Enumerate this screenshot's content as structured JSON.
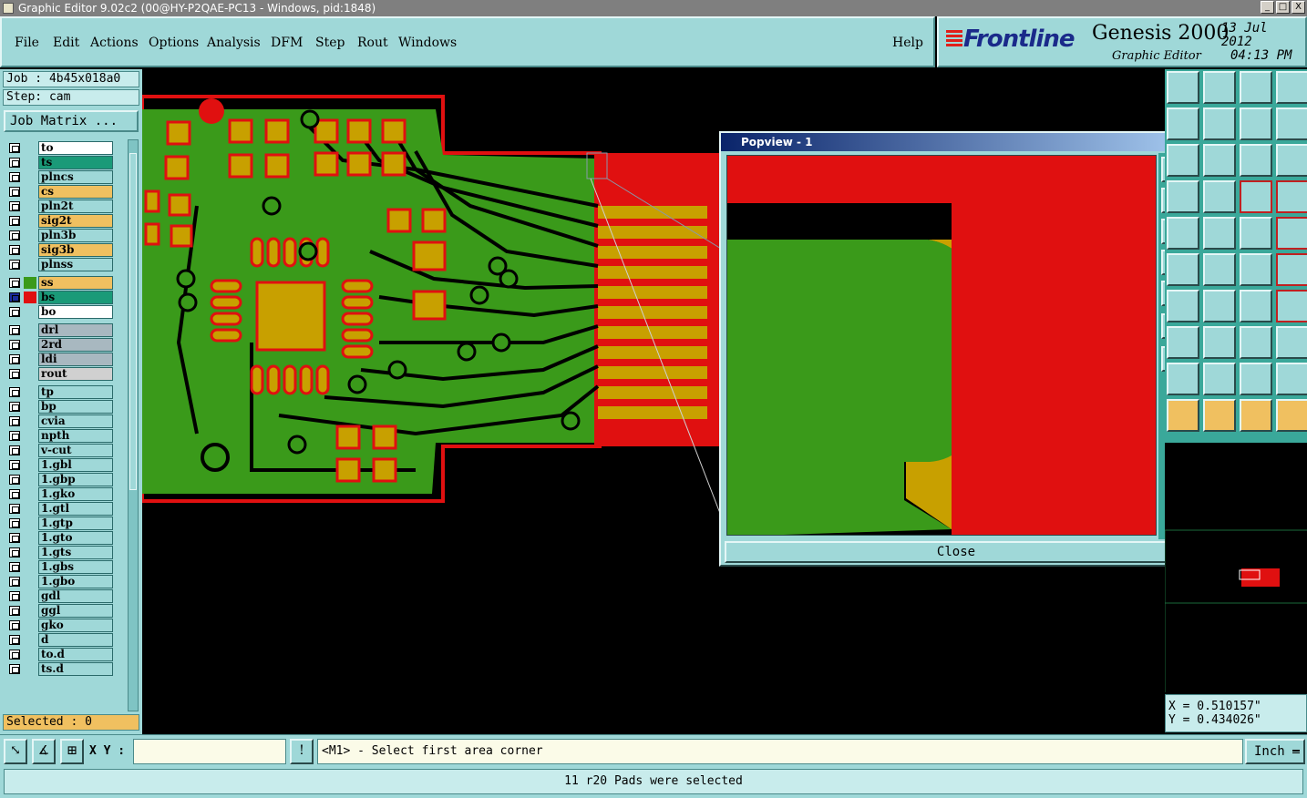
{
  "window": {
    "title": "Graphic Editor 9.02c2 (00@HY-P2QAE-PC13 - Windows, pid:1848)",
    "controls": [
      "_",
      "□",
      "X"
    ]
  },
  "menu": {
    "items": [
      "File",
      "Edit",
      "Actions",
      "Options",
      "Analysis",
      "DFM",
      "Step",
      "Rout",
      "Windows"
    ],
    "help": "Help"
  },
  "brand": {
    "logo": "Frontline",
    "product": "Genesis 2000",
    "subtitle": "Graphic Editor",
    "date": "13 Jul 2012",
    "time": "04:13 PM"
  },
  "job": {
    "job_line": "Job : 4b45x018a0",
    "step_line": "Step: cam",
    "matrix_button": "Job Matrix ..."
  },
  "layers": [
    {
      "name": "to",
      "color": "#ffffff"
    },
    {
      "name": "ts",
      "color": "#1a9a78"
    },
    {
      "name": "plncs",
      "color": "#9fd8d8"
    },
    {
      "name": "cs",
      "color": "#f0c060"
    },
    {
      "name": "pln2t",
      "color": "#9fd8d8"
    },
    {
      "name": "sig2t",
      "color": "#f0c060"
    },
    {
      "name": "pln3b",
      "color": "#9fd8d8"
    },
    {
      "name": "sig3b",
      "color": "#f0c060"
    },
    {
      "name": "plnss",
      "color": "#9fd8d8"
    },
    {
      "name": "ss",
      "color": "#f0c060",
      "swatch": "#3a9a1a"
    },
    {
      "name": "bs",
      "color": "#1a9a78",
      "swatch": "#e01010",
      "active": true
    },
    {
      "name": "bo",
      "color": "#ffffff"
    },
    {
      "name": "drl",
      "color": "#a8b8c0"
    },
    {
      "name": "2rd",
      "color": "#a8b8c0"
    },
    {
      "name": "ldi",
      "color": "#a8b8c0"
    },
    {
      "name": "rout",
      "color": "#d0d0d0"
    },
    {
      "name": "tp",
      "color": "#9fd8d8"
    },
    {
      "name": "bp",
      "color": "#9fd8d8"
    },
    {
      "name": "cvia",
      "color": "#9fd8d8"
    },
    {
      "name": "npth",
      "color": "#9fd8d8"
    },
    {
      "name": "v-cut",
      "color": "#9fd8d8"
    },
    {
      "name": "1.gbl",
      "color": "#9fd8d8"
    },
    {
      "name": "1.gbp",
      "color": "#9fd8d8"
    },
    {
      "name": "1.gko",
      "color": "#9fd8d8"
    },
    {
      "name": "1.gtl",
      "color": "#9fd8d8"
    },
    {
      "name": "1.gtp",
      "color": "#9fd8d8"
    },
    {
      "name": "1.gto",
      "color": "#9fd8d8"
    },
    {
      "name": "1.gts",
      "color": "#9fd8d8"
    },
    {
      "name": "1.gbs",
      "color": "#9fd8d8"
    },
    {
      "name": "1.gbo",
      "color": "#9fd8d8"
    },
    {
      "name": "gdl",
      "color": "#9fd8d8"
    },
    {
      "name": "ggl",
      "color": "#9fd8d8"
    },
    {
      "name": "gko",
      "color": "#9fd8d8"
    },
    {
      "name": "d",
      "color": "#9fd8d8"
    },
    {
      "name": "to.d",
      "color": "#9fd8d8"
    },
    {
      "name": "ts.d",
      "color": "#9fd8d8"
    }
  ],
  "selected_label": "Selected : 0",
  "popview": {
    "title": "Popview - 1",
    "close_label": "Close"
  },
  "coords": {
    "x": "X = 0.510157\"",
    "y": "Y = 0.434026\""
  },
  "bottom": {
    "xy_label": "X Y :",
    "xy_value": "",
    "prompt": "<M1> - Select first area corner",
    "units": "Inch",
    "status": "11 r20 Pads were selected"
  },
  "colors": {
    "panel": "#9fd8d8",
    "solder_mask": "#3a9a1a",
    "pad": "#c8a000",
    "outline": "#e01010"
  }
}
